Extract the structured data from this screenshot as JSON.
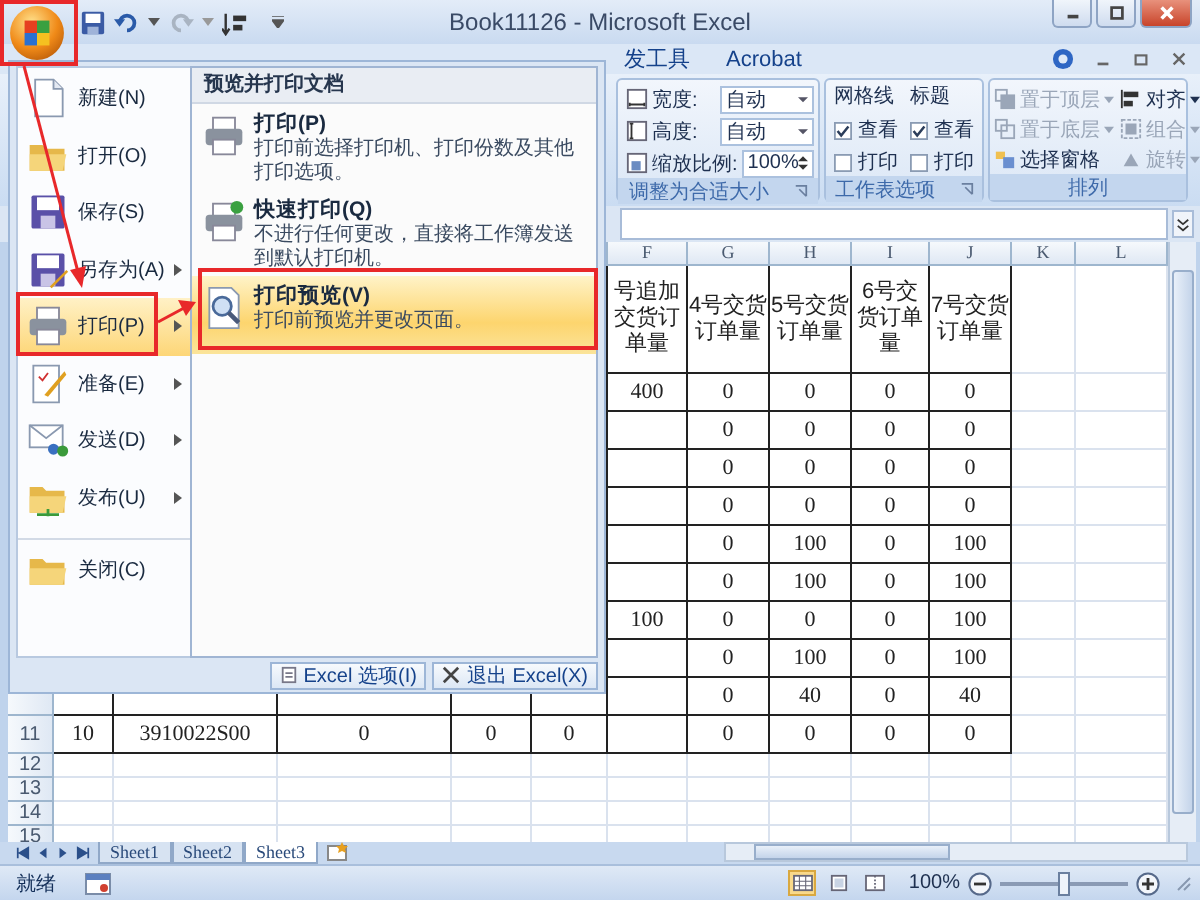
{
  "title_bar": {
    "title": "Book11126 - Microsoft Excel"
  },
  "ribbon_tabs": [
    {
      "label": "发工具",
      "selected": false
    },
    {
      "label": "Acrobat",
      "selected": false
    }
  ],
  "ribbon": {
    "scale_group": {
      "label": "调整为合适大小",
      "fields": [
        {
          "kind": "width",
          "label": "宽度:",
          "value": "自动"
        },
        {
          "kind": "height",
          "label": "高度:",
          "value": "自动"
        },
        {
          "kind": "scale",
          "label": "缩放比例:",
          "value": "100%"
        }
      ]
    },
    "sheet_options": {
      "label": "工作表选项",
      "columns": [
        {
          "title": "网格线",
          "options": [
            {
              "label": "查看",
              "checked": true
            },
            {
              "label": "打印",
              "checked": false
            }
          ]
        },
        {
          "title": "标题",
          "options": [
            {
              "label": "查看",
              "checked": true
            },
            {
              "label": "打印",
              "checked": false
            }
          ]
        }
      ]
    },
    "arrange": {
      "label": "排列",
      "items": [
        {
          "kind": "front",
          "label": "置于顶层",
          "dropdown": true,
          "disabled": true
        },
        {
          "kind": "back",
          "label": "置于底层",
          "dropdown": true,
          "disabled": true
        },
        {
          "kind": "pane",
          "label": "选择窗格",
          "dropdown": false,
          "disabled": false
        },
        {
          "kind": "align",
          "label": "对齐",
          "dropdown": true,
          "disabled": false
        },
        {
          "kind": "group",
          "label": "组合",
          "dropdown": true,
          "disabled": true
        },
        {
          "kind": "rotate",
          "label": "旋转",
          "dropdown": true,
          "disabled": true
        }
      ]
    }
  },
  "office_menu": {
    "commands": [
      {
        "kind": "new",
        "label": "新建(N)",
        "submenu": false,
        "selected": false,
        "separated": false
      },
      {
        "kind": "open",
        "label": "打开(O)",
        "submenu": false,
        "selected": false,
        "separated": false
      },
      {
        "kind": "save",
        "label": "保存(S)",
        "submenu": false,
        "selected": false,
        "separated": false
      },
      {
        "kind": "save_as",
        "label": "另存为(A)",
        "submenu": true,
        "selected": false,
        "separated": false
      },
      {
        "kind": "print",
        "label": "打印(P)",
        "submenu": true,
        "selected": true,
        "separated": false
      },
      {
        "kind": "prepare",
        "label": "准备(E)",
        "submenu": true,
        "selected": false,
        "separated": false
      },
      {
        "kind": "send",
        "label": "发送(D)",
        "submenu": true,
        "selected": false,
        "separated": false
      },
      {
        "kind": "publish",
        "label": "发布(U)",
        "submenu": true,
        "selected": false,
        "separated": false
      },
      {
        "kind": "close",
        "label": "关闭(C)",
        "submenu": false,
        "selected": false,
        "separated": true
      }
    ],
    "panel": {
      "title": "预览并打印文档",
      "items": [
        {
          "kind": "print",
          "title": "打印(P)",
          "description": "打印前选择打印机、打印份数及其他打印选项。",
          "selected": false
        },
        {
          "kind": "quick_print",
          "title": "快速打印(Q)",
          "description": "不进行任何更改，直接将工作簿发送到默认打印机。",
          "selected": false
        },
        {
          "kind": "preview",
          "title": "打印预览(V)",
          "description": "打印前预览并更改页面。",
          "selected": true
        }
      ]
    },
    "footer_buttons": [
      {
        "kind": "options",
        "label": "Excel 选项(I)"
      },
      {
        "kind": "exit",
        "label": "退出 Excel(X)"
      }
    ]
  },
  "sheet": {
    "column_headers": [
      "F",
      "G",
      "H",
      "I",
      "J",
      "K",
      "L"
    ],
    "rows": [
      {
        "cells": [
          null,
          null,
          null,
          null,
          null,
          "号追加交货订单量",
          "4号交货订单量",
          "5号交货订单量",
          "6号交货订单量",
          "7号交货订单量",
          null,
          null
        ]
      },
      {
        "cells": [
          null,
          null,
          null,
          null,
          null,
          "400",
          "0",
          "0",
          "0",
          "0",
          null,
          null
        ]
      },
      {
        "cells": [
          null,
          null,
          null,
          null,
          null,
          null,
          "0",
          "0",
          "0",
          "0",
          null,
          null
        ]
      },
      {
        "cells": [
          null,
          null,
          null,
          null,
          null,
          null,
          "0",
          "0",
          "0",
          "0",
          null,
          null
        ]
      },
      {
        "cells": [
          null,
          null,
          null,
          null,
          null,
          null,
          "0",
          "0",
          "0",
          "0",
          null,
          null
        ]
      },
      {
        "cells": [
          null,
          null,
          null,
          null,
          null,
          null,
          "0",
          "100",
          "0",
          "100",
          null,
          null
        ]
      },
      {
        "cells": [
          null,
          null,
          null,
          null,
          null,
          null,
          "0",
          "100",
          "0",
          "100",
          null,
          null
        ]
      },
      {
        "cells": [
          null,
          null,
          null,
          null,
          null,
          "100",
          "0",
          "0",
          "0",
          "100",
          null,
          null
        ]
      },
      {
        "cells": [
          null,
          null,
          null,
          null,
          null,
          null,
          "0",
          "100",
          "0",
          "100",
          null,
          null
        ]
      },
      {
        "cells": [
          null,
          null,
          null,
          null,
          null,
          null,
          "0",
          "40",
          "0",
          "40",
          null,
          null
        ]
      },
      {
        "number": "11",
        "cells": [
          "10",
          "3910022S00",
          "0",
          "0",
          "0",
          null,
          "0",
          "0",
          "0",
          "0",
          null,
          null
        ]
      },
      {
        "number": "12"
      },
      {
        "number": "13"
      },
      {
        "number": "14"
      },
      {
        "number": "15"
      }
    ]
  },
  "sheet_tabs": [
    {
      "label": "Sheet1",
      "selected": false
    },
    {
      "label": "Sheet2",
      "selected": false
    },
    {
      "label": "Sheet3",
      "selected": true
    }
  ],
  "status_bar": {
    "status": "就绪",
    "views": [
      {
        "kind": "normal",
        "selected": true
      },
      {
        "kind": "page_layout",
        "selected": false
      },
      {
        "kind": "page_break",
        "selected": false
      }
    ],
    "zoom": "100%",
    "zoom_slider": {
      "level": 0.5
    }
  }
}
